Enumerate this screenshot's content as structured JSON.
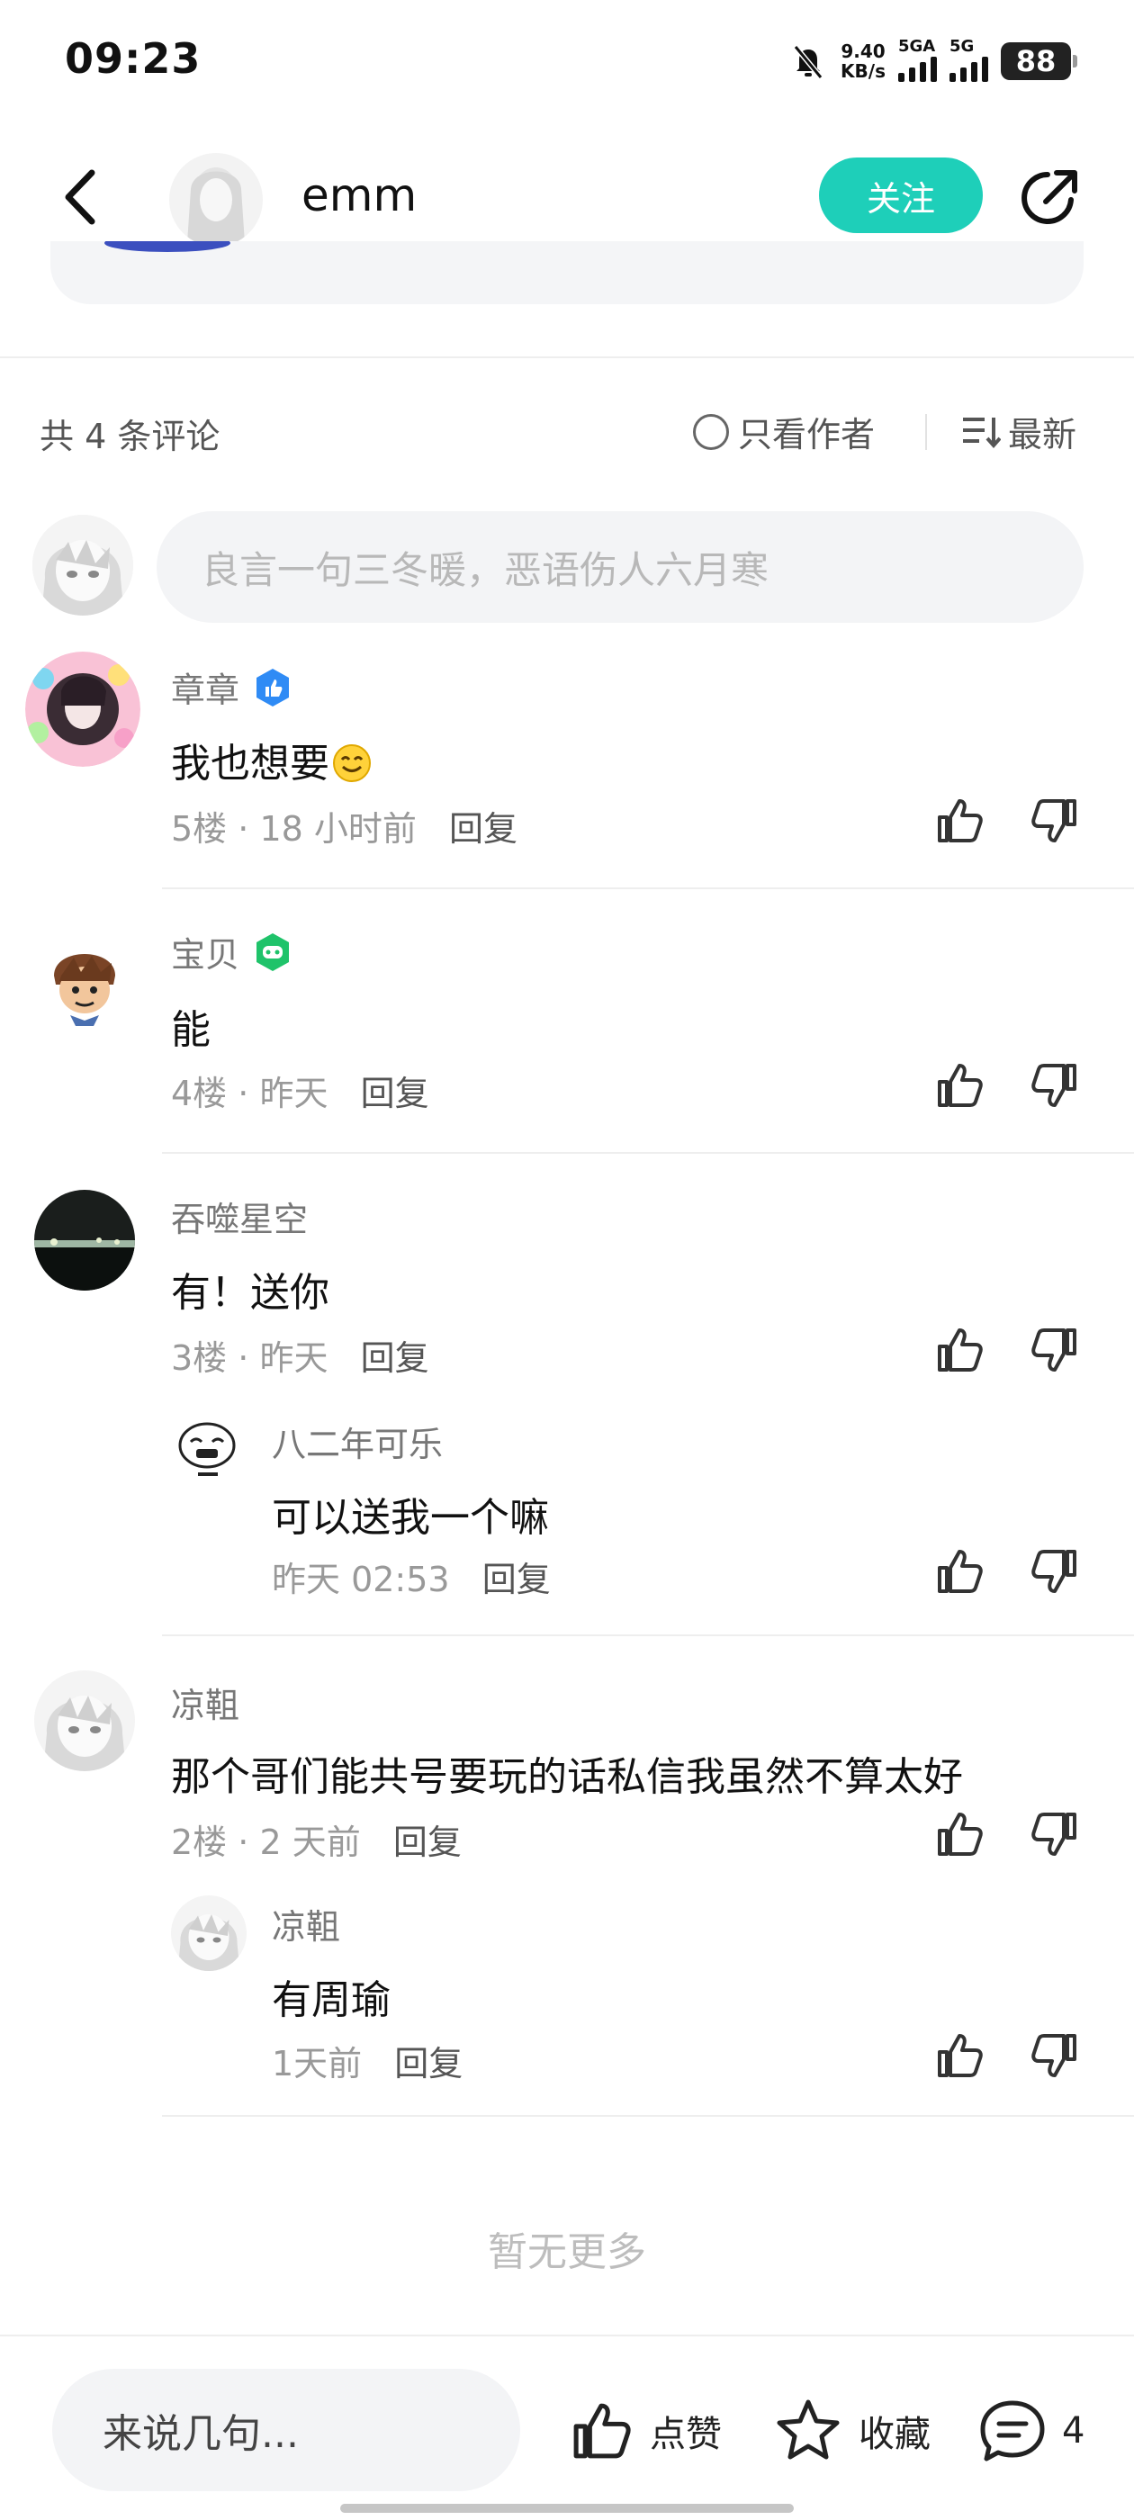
{
  "status_bar": {
    "time": "09:23",
    "net_speed_value": "9.40",
    "net_speed_unit": "KB/s",
    "sim1_label": "5GA",
    "sim2_label": "5G",
    "battery": "88"
  },
  "header": {
    "username": "emm",
    "follow_label": "关注"
  },
  "comments_header": {
    "count_text": "共 4 条评论",
    "author_only_label": "只看作者",
    "sort_label": "最新"
  },
  "composer": {
    "placeholder": "良言一句三冬暖，恶语伤人六月寒"
  },
  "comments": [
    {
      "user": "章章",
      "text": "我也想要",
      "floor": "5楼",
      "time": "18 小时前",
      "reply_label": "回复"
    },
    {
      "user": "宝贝",
      "text": "能",
      "floor": "4楼",
      "time": "昨天",
      "reply_label": "回复"
    },
    {
      "user": "吞噬星空",
      "text": "有！送你",
      "floor": "3楼",
      "time": "昨天",
      "reply_label": "回复",
      "reply": {
        "user": "八二年可乐",
        "text": "可以送我一个嘛",
        "time": "昨天 02:53",
        "reply_label": "回复"
      }
    },
    {
      "user": "凉靻",
      "text": "那个哥们能共号要玩的话私信我虽然不算太好",
      "floor": "2楼",
      "time": "2 天前",
      "reply_label": "回复",
      "reply": {
        "user": "凉靻",
        "text": "有周瑜",
        "time": "1天前",
        "reply_label": "回复"
      }
    }
  ],
  "no_more_text": "暂无更多",
  "bottom_bar": {
    "input_placeholder": "来说几句...",
    "like_label": "点赞",
    "favorite_label": "收藏",
    "comment_count": "4"
  },
  "colors": {
    "accent": "#1ecfb9",
    "verified_blue": "#2f8bf5",
    "game_badge_green": "#1fc36a"
  },
  "icons": [
    "back-arrow-icon",
    "share-icon",
    "sort-icon",
    "thumbs-up-icon",
    "thumbs-down-icon",
    "star-icon",
    "comment-bubble-icon",
    "mute-bell-icon",
    "verified-badge-icon",
    "game-badge-icon"
  ]
}
